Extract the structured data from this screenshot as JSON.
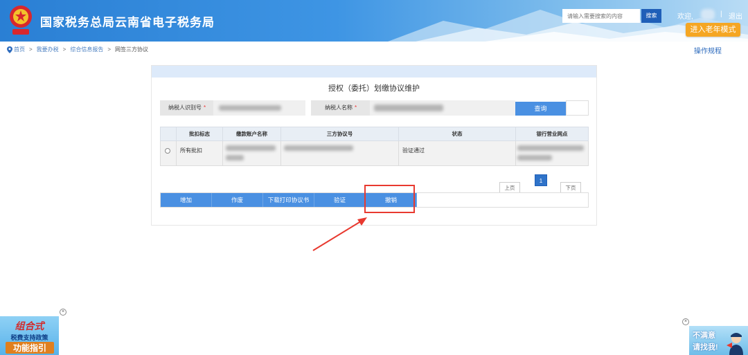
{
  "header": {
    "site_title": "国家税务总局云南省电子税务局",
    "emblem_icon": "tax-emblem-icon",
    "search_placeholder": "请输入需要搜索的内容",
    "search_button": "搜索",
    "welcome": "欢迎,",
    "separator": "|",
    "logout": "退出",
    "elder_mode_button": "进入老年模式"
  },
  "breadcrumb": {
    "icon": "location-pin-icon",
    "items": [
      "首页",
      "我要办税",
      "综合信息报告",
      "网签三方协议"
    ],
    "separator": ">"
  },
  "ops_link": "操作规程",
  "panel": {
    "title": "授权（委托）划缴协议维护",
    "filters": {
      "taxpayer_id_label": "纳税人识别号",
      "taxpayer_name_label": "纳税人名称",
      "required_mark": "*",
      "query_button": "查询"
    },
    "table": {
      "columns": [
        "批扣标志",
        "缴款账户名称",
        "三方协议号",
        "状态",
        "银行营业网点"
      ],
      "rows": [
        {
          "deduct_flag": "所有批扣",
          "status": "验证通过"
        }
      ]
    },
    "pager": {
      "prev": "上页",
      "current": "1",
      "next": "下页"
    },
    "actions": [
      "增加",
      "作废",
      "下载打印协议书",
      "验证",
      "撤销"
    ]
  },
  "floating_left": {
    "line1": "组合式",
    "line2": "税费支持政策",
    "line3": "功能指引",
    "close": "×"
  },
  "floating_right": {
    "line1": "不满意",
    "line2": "请找我!",
    "close": "×"
  },
  "colors": {
    "header_blue": "#2a7fd4",
    "button_blue": "#4a90e2",
    "elder_orange": "#f5a623",
    "highlight_red": "#e8392f"
  }
}
